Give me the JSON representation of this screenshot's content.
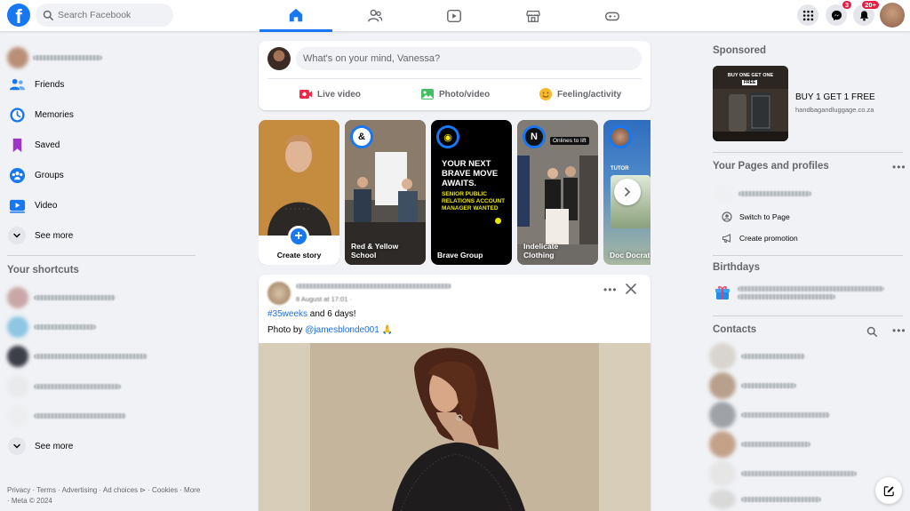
{
  "header": {
    "logo_letter": "f",
    "search_placeholder": "Search Facebook",
    "nav_tabs": [
      "Home",
      "Friends",
      "Video",
      "Marketplace",
      "Gaming"
    ],
    "messenger_badge": "3",
    "notifications_badge": "20+"
  },
  "left_sidebar": {
    "items": [
      {
        "label": "Friends",
        "icon": "friends-icon"
      },
      {
        "label": "Memories",
        "icon": "memories-icon"
      },
      {
        "label": "Saved",
        "icon": "saved-icon"
      },
      {
        "label": "Groups",
        "icon": "groups-icon"
      },
      {
        "label": "Video",
        "icon": "video-icon"
      }
    ],
    "see_more": "See more",
    "shortcuts_title": "Your shortcuts",
    "shortcuts_see_more": "See more",
    "footer": "Privacy · Terms · Advertising · Ad choices ⊳ · Cookies · More · Meta © 2024"
  },
  "composer": {
    "prompt": "What's on your mind, Vanessa?",
    "actions": [
      "Live video",
      "Photo/video",
      "Feeling/activity"
    ]
  },
  "stories": {
    "create_label": "Create story",
    "items": [
      {
        "name": "Red & Yellow School",
        "ring": "&"
      },
      {
        "name": "Brave Group",
        "ring": "◉",
        "headline": "YOUR NEXT BRAVE MOVE AWAITS.",
        "sub": "SENIOR PUBLIC RELATIONS ACCOUNT MANAGER WANTED"
      },
      {
        "name": "Indelicate Clothing",
        "ring": "N",
        "tag": "Onlines to lift"
      },
      {
        "name": "Doc Docrat",
        "ring": "",
        "tag": "TUTOR"
      }
    ]
  },
  "post": {
    "date": "8 August at 17:01 · ",
    "hashtag": "#35weeks",
    "text_rest": " and 6 days!",
    "credit_prefix": "Photo by ",
    "credit_handle": "@jamesblonde001",
    "credit_emoji": "🙏"
  },
  "right_sidebar": {
    "sponsored_title": "Sponsored",
    "ad_title": "BUY 1 GET 1 FREE",
    "ad_url": "handbagandluggage.co.za",
    "ad_banner": "BUY ONE GET ONE",
    "ad_banner_tag": "FREE",
    "pages_title": "Your Pages and profiles",
    "switch_to_page": "Switch to Page",
    "create_promotion": "Create promotion",
    "birthdays_title": "Birthdays",
    "contacts_title": "Contacts"
  },
  "colors": {
    "brand": "#1877f2",
    "background": "#f0f2f5",
    "badge": "#e41e3f"
  }
}
